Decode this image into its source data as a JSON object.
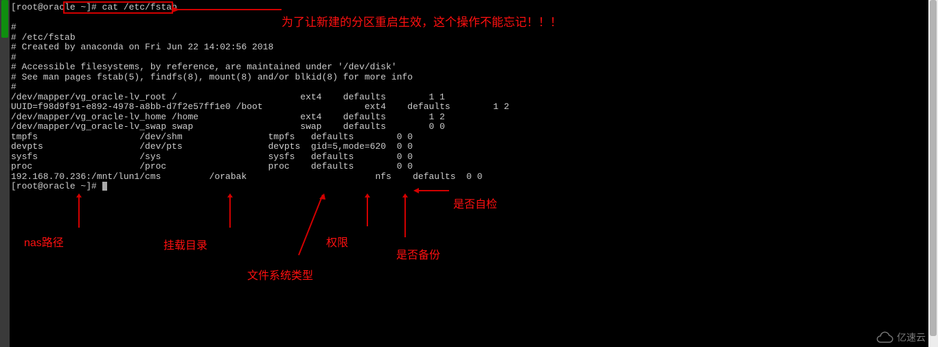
{
  "prompt": {
    "user_host": "[root@oracle ~]#",
    "command": "cat /etc/fstab"
  },
  "output": {
    "blank1": "",
    "header1": "#",
    "header2": "# /etc/fstab",
    "header3": "# Created by anaconda on Fri Jun 22 14:02:56 2018",
    "header4": "#",
    "header5": "# Accessible filesystems, by reference, are maintained under '/dev/disk'",
    "header6": "# See man pages fstab(5), findfs(8), mount(8) and/or blkid(8) for more info",
    "header7": "#",
    "line1": "/dev/mapper/vg_oracle-lv_root /                       ext4    defaults        1 1",
    "line2": "UUID=f98d9f91-e892-4978-a8bb-d7f2e57ff1e0 /boot                   ext4    defaults        1 2",
    "line3": "/dev/mapper/vg_oracle-lv_home /home                   ext4    defaults        1 2",
    "line4": "/dev/mapper/vg_oracle-lv_swap swap                    swap    defaults        0 0",
    "line5": "tmpfs                   /dev/shm                tmpfs   defaults        0 0",
    "line6": "devpts                  /dev/pts                devpts  gid=5,mode=620  0 0",
    "line7": "sysfs                   /sys                    sysfs   defaults        0 0",
    "line8": "proc                    /proc                   proc    defaults        0 0",
    "line9": "192.168.70.236:/mnt/lun1/cms         /orabak                        nfs    defaults  0 0"
  },
  "prompt2": "[root@oracle ~]# ",
  "annotations": {
    "important": "为了让新建的分区重启生效，这个操作不能忘记！！！",
    "nas_path": "nas路径",
    "mount_dir": "挂载目录",
    "fs_type": "文件系统类型",
    "permission": "权限",
    "backup": "是否备份",
    "fsck": "是否自检"
  },
  "watermark": "亿速云"
}
